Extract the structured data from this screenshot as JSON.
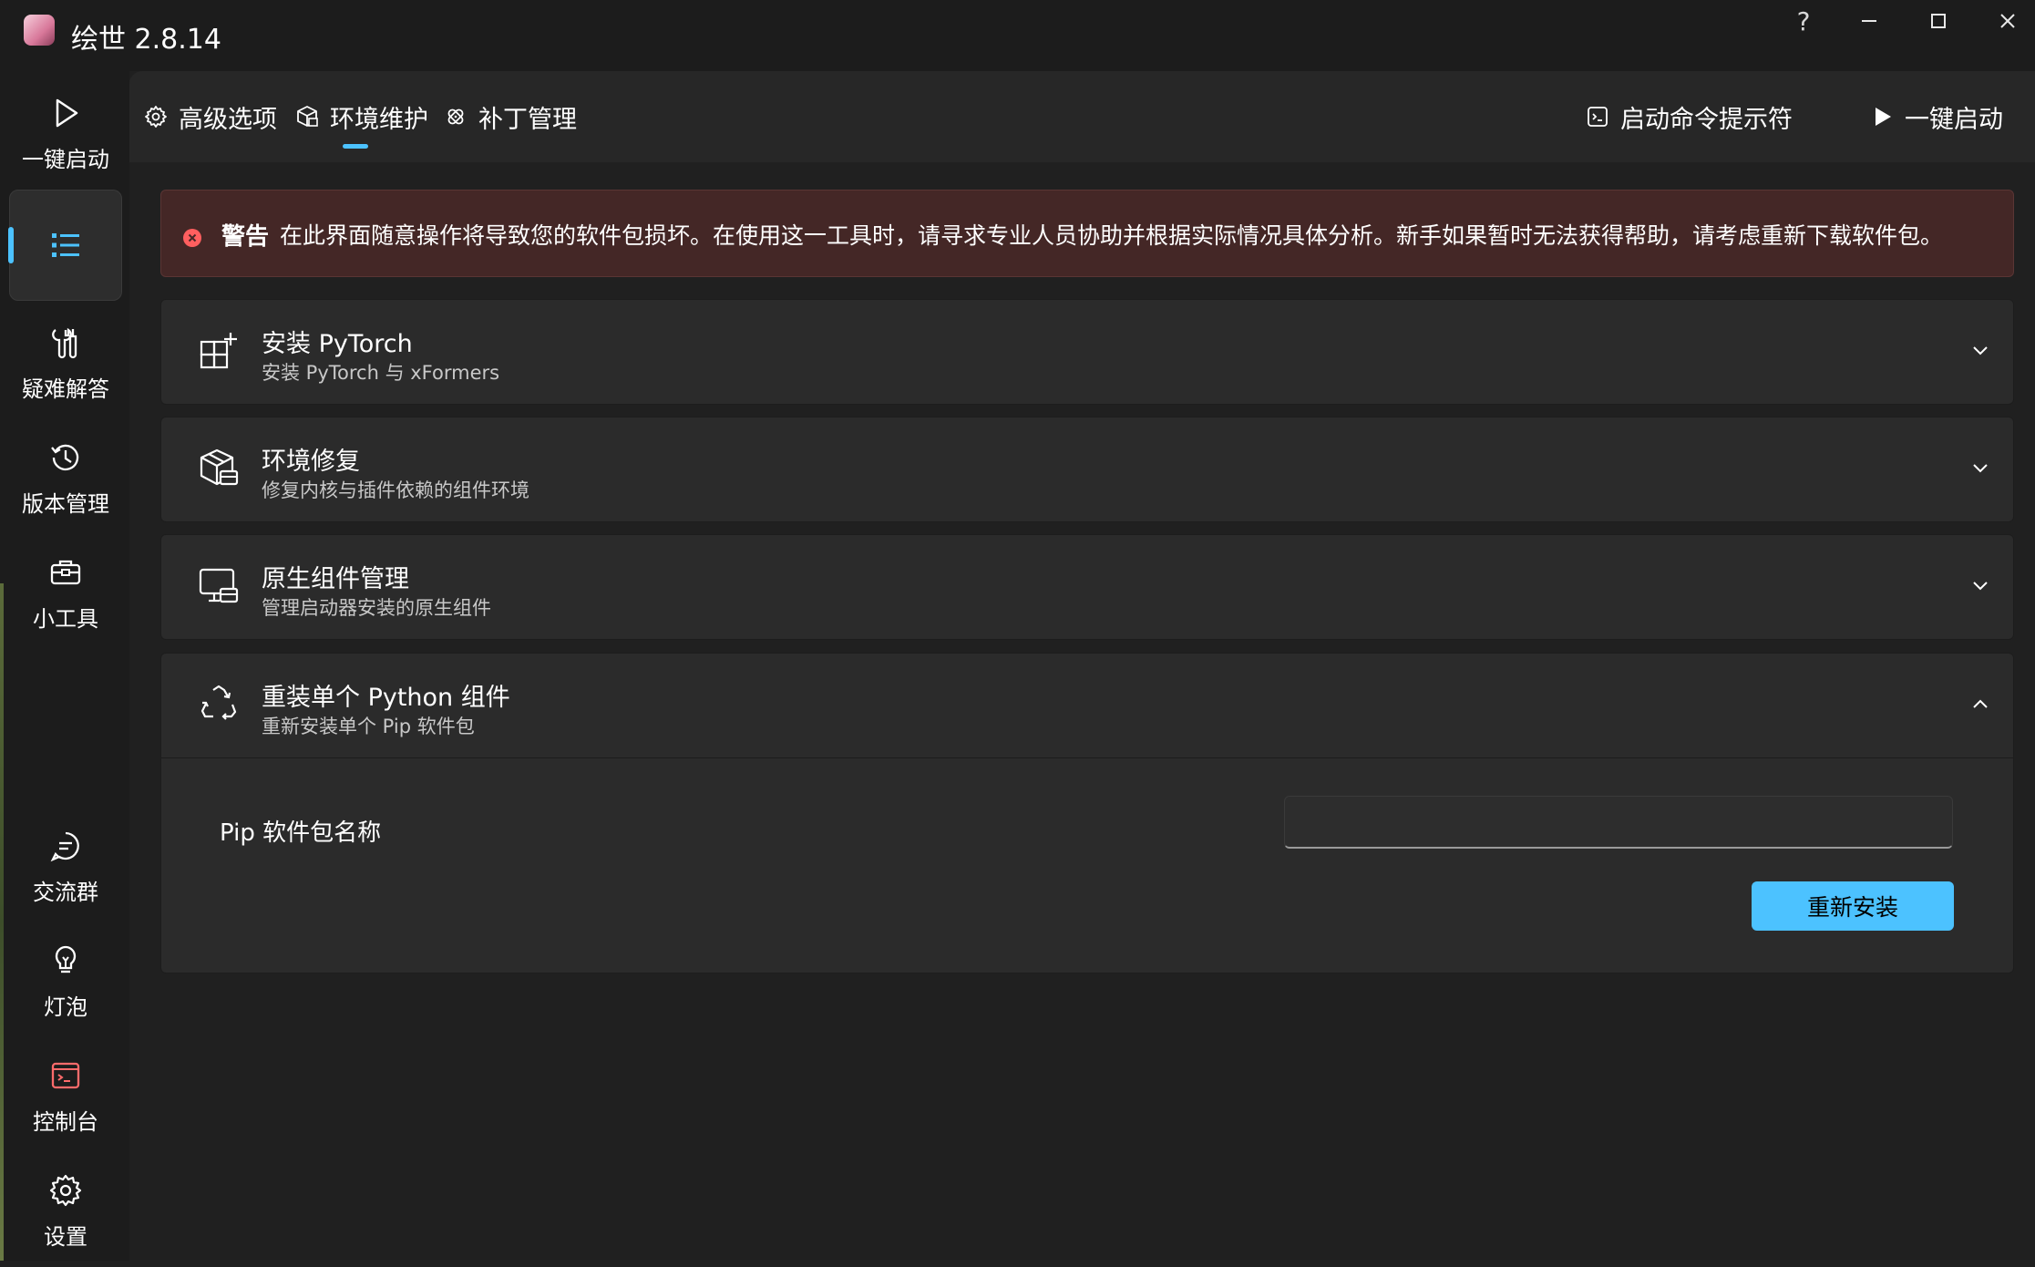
{
  "window": {
    "title": "绘世 2.8.14",
    "help_label": "?"
  },
  "sidebar": {
    "items": [
      {
        "label": "一键启动",
        "icon": "play-icon"
      },
      {
        "label": "",
        "icon": "list-icon",
        "selected": true
      },
      {
        "label": "疑难解答",
        "icon": "tools-icon"
      },
      {
        "label": "版本管理",
        "icon": "history-icon"
      },
      {
        "label": "小工具",
        "icon": "toolbox-icon"
      }
    ],
    "bottom_items": [
      {
        "label": "交流群",
        "icon": "chat-icon"
      },
      {
        "label": "灯泡",
        "icon": "bulb-icon"
      },
      {
        "label": "控制台",
        "icon": "console-icon"
      },
      {
        "label": "设置",
        "icon": "gear-icon"
      }
    ]
  },
  "tabs": [
    {
      "label": "高级选项",
      "icon": "gear-icon"
    },
    {
      "label": "环境维护",
      "icon": "package-icon",
      "active": true
    },
    {
      "label": "补丁管理",
      "icon": "patch-icon"
    }
  ],
  "toolbar": {
    "terminal_label": "启动命令提示符",
    "launch_label": "一键启动"
  },
  "alert": {
    "title": "警告",
    "message": "在此界面随意操作将导致您的软件包损坏。在使用这一工具时，请寻求专业人员协助并根据实际情况具体分析。新手如果暂时无法获得帮助，请考虑重新下载软件包。",
    "color": "#ff5f5f"
  },
  "cards": [
    {
      "title": "安装 PyTorch",
      "subtitle": "安装 PyTorch 与 xFormers",
      "icon": "grid-add-icon",
      "expanded": false
    },
    {
      "title": "环境修复",
      "subtitle": "修复内核与插件依赖的组件环境",
      "icon": "box-repair-icon",
      "expanded": false
    },
    {
      "title": "原生组件管理",
      "subtitle": "管理启动器安装的原生组件",
      "icon": "monitor-toolbox-icon",
      "expanded": false
    },
    {
      "title": "重装单个 Python 组件",
      "subtitle": "重新安装单个 Pip 软件包",
      "icon": "recycle-icon",
      "expanded": true
    }
  ],
  "reinstall": {
    "field_label": "Pip 软件包名称",
    "input_value": "",
    "button_label": "重新安装"
  },
  "colors": {
    "accent": "#4cc2ff",
    "background": "#202020",
    "card": "#2b2b2b",
    "alert_bg": "#442726"
  }
}
